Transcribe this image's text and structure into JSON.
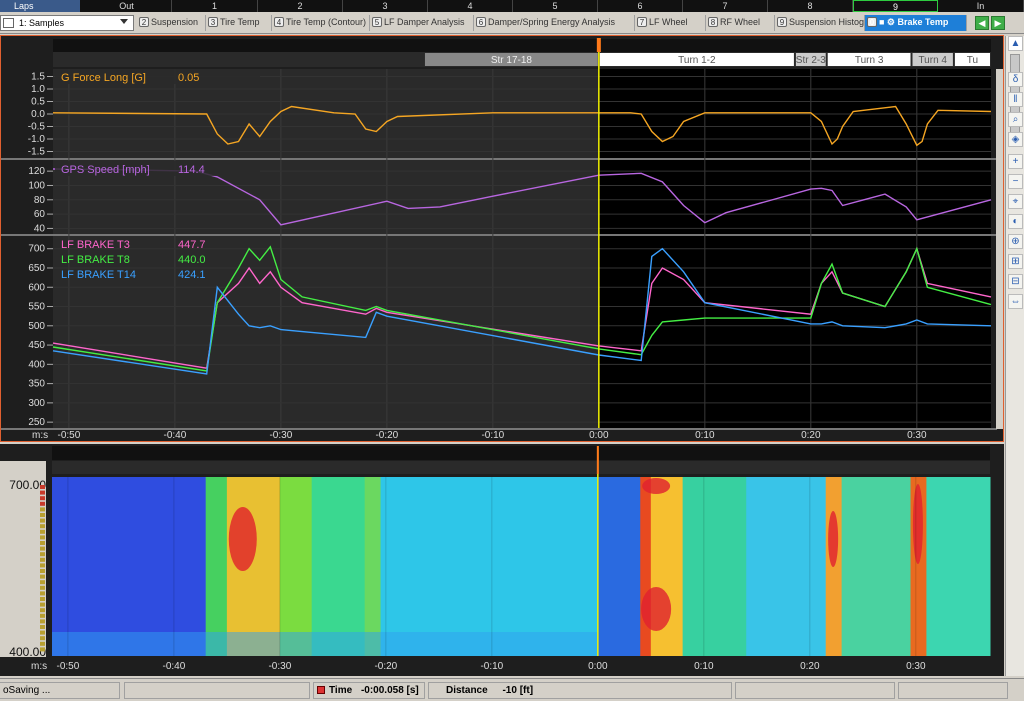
{
  "lap_bar": {
    "label": "Laps",
    "laps": [
      "Out",
      "1",
      "2",
      "3",
      "4",
      "5",
      "6",
      "7",
      "8",
      "9",
      "In"
    ],
    "current_lap": "9"
  },
  "workspace": {
    "selector_label": "1: Samples"
  },
  "tabs": [
    {
      "num": "2",
      "label": "Suspension"
    },
    {
      "num": "3",
      "label": "Tire Temp"
    },
    {
      "num": "4",
      "label": "Tire Temp (Contour)"
    },
    {
      "num": "5",
      "label": "LF Damper Analysis"
    },
    {
      "num": "6",
      "label": "Damper/Spring Energy Analysis"
    },
    {
      "num": "7",
      "label": "LF Wheel"
    },
    {
      "num": "8",
      "label": "RF Wheel"
    },
    {
      "num": "9",
      "label": "Suspension Histogram"
    },
    {
      "num": "0",
      "label": "Brake Temp",
      "active": true
    }
  ],
  "track_sections_top": [
    "Str 17-18",
    "Turn 1-2",
    "Str 2-3",
    "Turn 3",
    "Turn 4",
    "Tu"
  ],
  "time_axis": {
    "unit_label": "m:s",
    "ticks": [
      "-0:50",
      "-0:40",
      "-0:30",
      "-0:20",
      "-0:10",
      "0:00",
      "0:10",
      "0:20",
      "0:30"
    ],
    "tick_seconds": [
      -50,
      -40,
      -30,
      -20,
      -10,
      0,
      10,
      20,
      30
    ],
    "range_seconds": [
      -51.5,
      37
    ]
  },
  "chart_data": [
    {
      "type": "line",
      "series": [
        {
          "name": "G Force Long [G]",
          "cursor_value": "0.05",
          "color": "#f5a623"
        }
      ],
      "y_ticks": [
        "1.5",
        "1.0",
        "0.5",
        "0.0",
        "-0.5",
        "-1.0",
        "-1.5"
      ],
      "ylim": [
        -1.6,
        1.6
      ],
      "x": [
        -51.5,
        -37,
        -36,
        -35,
        -34,
        -33,
        -32,
        -31,
        -30,
        -29,
        -25,
        -23,
        -22,
        -21,
        -20,
        -19,
        -10,
        0,
        3,
        4,
        5,
        6,
        7,
        8,
        10,
        20,
        21,
        22,
        22.5,
        23,
        24,
        28,
        29,
        30,
        30.5,
        31,
        32,
        37
      ],
      "values": [
        0.05,
        0.0,
        -0.8,
        -1.2,
        -1.1,
        -0.4,
        -0.9,
        -0.3,
        0.1,
        0.3,
        0.05,
        0.0,
        -0.6,
        -0.7,
        -0.3,
        -0.1,
        0.05,
        0.05,
        0.05,
        0.0,
        -0.7,
        -1.1,
        -0.9,
        -0.3,
        0.05,
        0.05,
        -0.3,
        -1.2,
        -1.0,
        -0.5,
        0.1,
        0.3,
        -0.4,
        -1.25,
        -1.1,
        -0.4,
        0.15,
        0.1
      ]
    },
    {
      "type": "line",
      "series": [
        {
          "name": "GPS Speed [mph]",
          "cursor_value": "114.4",
          "color": "#b866e0"
        }
      ],
      "y_ticks": [
        "120",
        "100",
        "80",
        "60",
        "40"
      ],
      "ylim": [
        35,
        130
      ],
      "x": [
        -51.5,
        -45,
        -38,
        -36,
        -32,
        -30,
        -20,
        -18,
        -15,
        -10,
        0,
        4,
        6,
        8,
        10,
        12,
        20,
        21,
        22,
        23,
        25,
        27,
        29,
        30,
        37
      ],
      "values": [
        123,
        122,
        120,
        112,
        80,
        45,
        78,
        68,
        70,
        85,
        114.4,
        117,
        105,
        72,
        48,
        62,
        95,
        96,
        93,
        72,
        80,
        88,
        70,
        52,
        80
      ]
    },
    {
      "type": "line",
      "series": [
        {
          "name": "LF BRAKE T3",
          "cursor_value": "447.7",
          "color": "#ff66cc",
          "x": [
            -51.5,
            -37,
            -36,
            -34,
            -33,
            -32,
            -31,
            -30,
            -28,
            -22,
            -21,
            -20,
            0,
            4,
            5,
            6,
            8,
            10,
            20,
            21,
            22,
            23,
            27,
            29,
            30,
            31,
            37
          ],
          "values": [
            455,
            390,
            560,
            610,
            650,
            610,
            640,
            600,
            560,
            530,
            545,
            535,
            447.7,
            435,
            610,
            650,
            620,
            560,
            530,
            610,
            640,
            585,
            550,
            640,
            700,
            610,
            575
          ]
        },
        {
          "name": "LF BRAKE T8",
          "cursor_value": "440.0",
          "color": "#44ee44",
          "x": [
            -51.5,
            -37,
            -36,
            -34,
            -33,
            -32,
            -31,
            -30,
            -28,
            -22,
            -21,
            -20,
            0,
            4,
            5,
            6,
            8,
            10,
            20,
            21,
            22,
            23,
            27,
            29,
            30,
            31,
            37
          ],
          "values": [
            445,
            383,
            560,
            650,
            700,
            670,
            705,
            620,
            575,
            540,
            550,
            540,
            440,
            425,
            475,
            510,
            515,
            520,
            520,
            610,
            660,
            585,
            550,
            640,
            700,
            600,
            555
          ]
        },
        {
          "name": "LF BRAKE T14",
          "cursor_value": "424.1",
          "color": "#3aa0ff",
          "x": [
            -51.5,
            -37,
            -36,
            -34,
            -33,
            -32,
            -31,
            -30,
            -28,
            -22,
            -21,
            -20,
            0,
            4,
            5,
            6,
            8,
            10,
            20,
            21,
            22,
            23,
            27,
            29,
            30,
            31,
            37
          ],
          "values": [
            435,
            375,
            600,
            530,
            500,
            495,
            500,
            490,
            485,
            470,
            535,
            525,
            424.1,
            410,
            680,
            700,
            640,
            560,
            505,
            505,
            510,
            500,
            495,
            505,
            515,
            505,
            500
          ]
        }
      ],
      "y_ticks": [
        "700",
        "650",
        "600",
        "550",
        "500",
        "450",
        "400",
        "350",
        "300",
        "250"
      ],
      "ylim": [
        240,
        720
      ]
    },
    {
      "type": "heatmap",
      "y_ticks": [
        "700.00",
        "400.00"
      ],
      "ylim": [
        400,
        700
      ]
    }
  ],
  "status_bar": {
    "left_text": "oSaving ...",
    "time_label": "Time",
    "time_value": "-0:00.058 [s]",
    "distance_label": "Distance",
    "distance_value": "-10 [ft]"
  },
  "colors": {
    "cursor": "#f2f200",
    "panel_bg_past": "#2a2a2a",
    "panel_bg_future": "#000000",
    "border_accent": "#e06030"
  }
}
